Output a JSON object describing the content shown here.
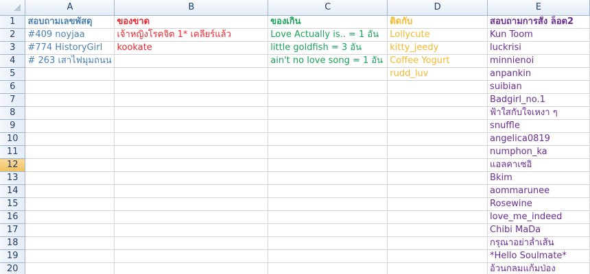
{
  "colors": {
    "col_a": "#4a7fb0",
    "col_b": "#e8262c",
    "col_c": "#1aa158",
    "col_d": "#f5b82e",
    "col_e": "#6a2d91",
    "active_row_header": "#f1c15f"
  },
  "sheet": {
    "columns": [
      "A",
      "B",
      "C",
      "D",
      "E"
    ],
    "rows": [
      {
        "n": "1",
        "a": "สอบถามเลขพัสดุ",
        "b": "ของขาด",
        "c": "ของเกิน",
        "d": "ติดกับ",
        "e": "สอบถามการสั่ง ล็อต2"
      },
      {
        "n": "2",
        "a": "#409 noyjaa",
        "b": "เจ้าหญิงโรคจิต 1*  เคลียร์แล้ว",
        "c": "Love Actually is.. = 1 อัน",
        "d": "Lollycute",
        "e": "Kun Toom"
      },
      {
        "n": "3",
        "a": "#774 HistoryGirl",
        "b": "kookate",
        "c": "little goldfish = 3 อัน",
        "d": "kitty_jeedy",
        "e": "luckrisi"
      },
      {
        "n": "4",
        "a": "# 263 เสาไฟมุมถนน",
        "b": "",
        "c": "ain't no love song  = 1 อัน",
        "d": "Coffee Yogurt",
        "e": "minnienoi"
      },
      {
        "n": "5",
        "a": "",
        "b": "",
        "c": "",
        "d": "rudd_luv",
        "e": "anpankin"
      },
      {
        "n": "6",
        "a": "",
        "b": "",
        "c": "",
        "d": "",
        "e": "suibian"
      },
      {
        "n": "7",
        "a": "",
        "b": "",
        "c": "",
        "d": "",
        "e": "Badgirl_no.1"
      },
      {
        "n": "8",
        "a": "",
        "b": "",
        "c": "",
        "d": "",
        "e": "ฟ้าใสกับใจเหงา ๆ"
      },
      {
        "n": "9",
        "a": "",
        "b": "",
        "c": "",
        "d": "",
        "e": "snuffle"
      },
      {
        "n": "10",
        "a": "",
        "b": "",
        "c": "",
        "d": "",
        "e": "angelica0819"
      },
      {
        "n": "11",
        "a": "",
        "b": "",
        "c": "",
        "d": "",
        "e": "numphon_ka"
      },
      {
        "n": "12",
        "a": "",
        "b": "",
        "c": "",
        "d": "",
        "e": "แอลคาเซอิ"
      },
      {
        "n": "13",
        "a": "",
        "b": "",
        "c": "",
        "d": "",
        "e": "Bkim"
      },
      {
        "n": "14",
        "a": "",
        "b": "",
        "c": "",
        "d": "",
        "e": "aommarunee"
      },
      {
        "n": "15",
        "a": "",
        "b": "",
        "c": "",
        "d": "",
        "e": "Rosewine"
      },
      {
        "n": "16",
        "a": "",
        "b": "",
        "c": "",
        "d": "",
        "e": "love_me_indeed"
      },
      {
        "n": "17",
        "a": "",
        "b": "",
        "c": "",
        "d": "",
        "e": "Chibi MaDa"
      },
      {
        "n": "18",
        "a": "",
        "b": "",
        "c": "",
        "d": "",
        "e": "กรุณาอย่าล้ำเส้น"
      },
      {
        "n": "19",
        "a": "",
        "b": "",
        "c": "",
        "d": "",
        "e": "*Hello Soulmate*"
      },
      {
        "n": "20",
        "a": "",
        "b": "",
        "c": "",
        "d": "",
        "e": "อ้วนกลมแก้มป่อง"
      }
    ],
    "active_row": "12"
  }
}
